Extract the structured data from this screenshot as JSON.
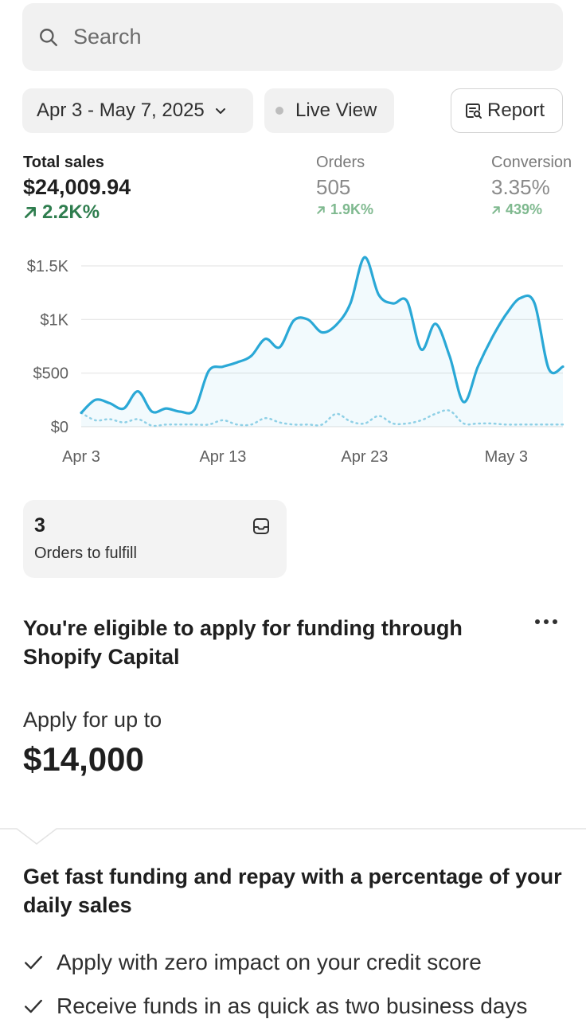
{
  "search": {
    "placeholder": "Search",
    "icon": "search-icon"
  },
  "toolbar": {
    "date_range": "Apr 3 - May 7, 2025",
    "live_view": "Live View",
    "report": "Report"
  },
  "metrics": {
    "total_sales": {
      "label": "Total sales",
      "value": "$24,009.94",
      "change": "2.2K%"
    },
    "orders": {
      "label": "Orders",
      "value": "505",
      "change": "1.9K%"
    },
    "conversion": {
      "label": "Conversion",
      "value": "3.35%",
      "change": "439%"
    }
  },
  "colors": {
    "accent_line": "#2aa8d6",
    "positive": "#2e7d4e",
    "positive_muted": "#7fb98f"
  },
  "chart_data": {
    "type": "line",
    "y_ticks": [
      "$1.5K",
      "$1K",
      "$500",
      "$0"
    ],
    "x_ticks": [
      "Apr 3",
      "Apr 13",
      "Apr 23",
      "May 3"
    ],
    "ylim": [
      0,
      1500
    ],
    "grid": true,
    "series": [
      {
        "x": [
          "Apr 3",
          "Apr 4",
          "Apr 5",
          "Apr 6",
          "Apr 7",
          "Apr 8",
          "Apr 9",
          "Apr 10",
          "Apr 11",
          "Apr 12",
          "Apr 13",
          "Apr 14",
          "Apr 15",
          "Apr 16",
          "Apr 17",
          "Apr 18",
          "Apr 19",
          "Apr 20",
          "Apr 21",
          "Apr 22",
          "Apr 23",
          "Apr 24",
          "Apr 25",
          "Apr 26",
          "Apr 27",
          "Apr 28",
          "Apr 29",
          "Apr 30",
          "May 1",
          "May 2",
          "May 3",
          "May 4",
          "May 5",
          "May 6",
          "May 7"
        ],
        "values": [
          130,
          250,
          220,
          170,
          330,
          140,
          170,
          140,
          160,
          520,
          560,
          600,
          660,
          820,
          740,
          990,
          1000,
          880,
          950,
          1150,
          1580,
          1230,
          1150,
          1170,
          720,
          960,
          660,
          230,
          560,
          830,
          1050,
          1200,
          1150,
          540,
          560
        ]
      },
      {
        "x": [
          "Apr 3",
          "Apr 4",
          "Apr 5",
          "Apr 6",
          "Apr 7",
          "Apr 8",
          "Apr 9",
          "Apr 10",
          "Apr 11",
          "Apr 12",
          "Apr 13",
          "Apr 14",
          "Apr 15",
          "Apr 16",
          "Apr 17",
          "Apr 18",
          "Apr 19",
          "Apr 20",
          "Apr 21",
          "Apr 22",
          "Apr 23",
          "Apr 24",
          "Apr 25",
          "Apr 26",
          "Apr 27",
          "Apr 28",
          "Apr 29",
          "Apr 30",
          "May 1",
          "May 2",
          "May 3",
          "May 4",
          "May 5",
          "May 6",
          "May 7"
        ],
        "values": [
          130,
          60,
          70,
          40,
          70,
          10,
          20,
          20,
          20,
          20,
          60,
          20,
          20,
          80,
          40,
          20,
          20,
          20,
          120,
          50,
          30,
          100,
          30,
          30,
          60,
          120,
          150,
          30,
          30,
          30,
          20,
          20,
          20,
          20,
          20
        ]
      }
    ]
  },
  "fulfill": {
    "count": "3",
    "label": "Orders to fulfill"
  },
  "capital": {
    "title": "You're eligible to apply for funding through Shopify Capital",
    "apply_label": "Apply for up to",
    "amount": "$14,000",
    "subtitle": "Get fast funding and repay with a percentage of your daily sales",
    "bullets": [
      "Apply with zero impact on your credit score",
      "Receive funds in as quick as two business days"
    ]
  }
}
